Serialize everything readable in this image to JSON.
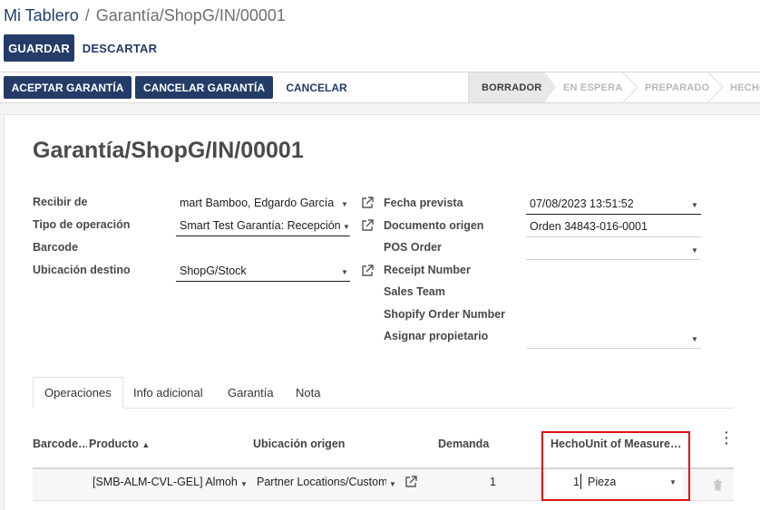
{
  "breadcrumb": {
    "root": "Mi Tablero",
    "current": "Garantía/ShopG/IN/00001"
  },
  "toolbar": {
    "save": "GUARDAR",
    "discard": "DESCARTAR"
  },
  "actions": {
    "accept": "ACEPTAR GARANTÍA",
    "cancel_warranty": "CANCELAR GARANTÍA",
    "cancel": "CANCELAR"
  },
  "stages": [
    "BORRADOR",
    "EN ESPERA",
    "PREPARADO",
    "HECHO"
  ],
  "record": {
    "title": "Garantía/ShopG/IN/00001",
    "left_fields": [
      {
        "label": "Recibir de",
        "value": "mart Bamboo, Edgardo García"
      },
      {
        "label": "Tipo de operación",
        "value": "Smart Test Garantía: Recepción"
      },
      {
        "label": "Barcode",
        "value": ""
      },
      {
        "label": "Ubicación destino",
        "value": "ShopG/Stock"
      }
    ],
    "right_fields": [
      {
        "label": "Fecha prevista",
        "value": "07/08/2023 13:51:52"
      },
      {
        "label": "Documento origen",
        "value": "Orden 34843-016-0001"
      },
      {
        "label": "POS Order",
        "value": ""
      },
      {
        "label": "Receipt Number",
        "value": ""
      },
      {
        "label": "Sales Team",
        "value": ""
      },
      {
        "label": "Shopify Order Number",
        "value": ""
      },
      {
        "label": "Asignar propietario",
        "value": ""
      }
    ]
  },
  "tabs": [
    "Operaciones",
    "Info adicional",
    "Garantía",
    "Nota"
  ],
  "table": {
    "headers": {
      "barcode": "Barcode…",
      "product": "Producto",
      "origin": "Ubicación origen",
      "demand": "Demanda",
      "done_uom": "HechoUnit of Measure…"
    },
    "rows": [
      {
        "product": "[SMB-ALM-CVL-GEL] Almohada",
        "origin": "Partner Locations/Customers",
        "demand": "1",
        "done": "1",
        "uom": "Pieza"
      }
    ]
  }
}
